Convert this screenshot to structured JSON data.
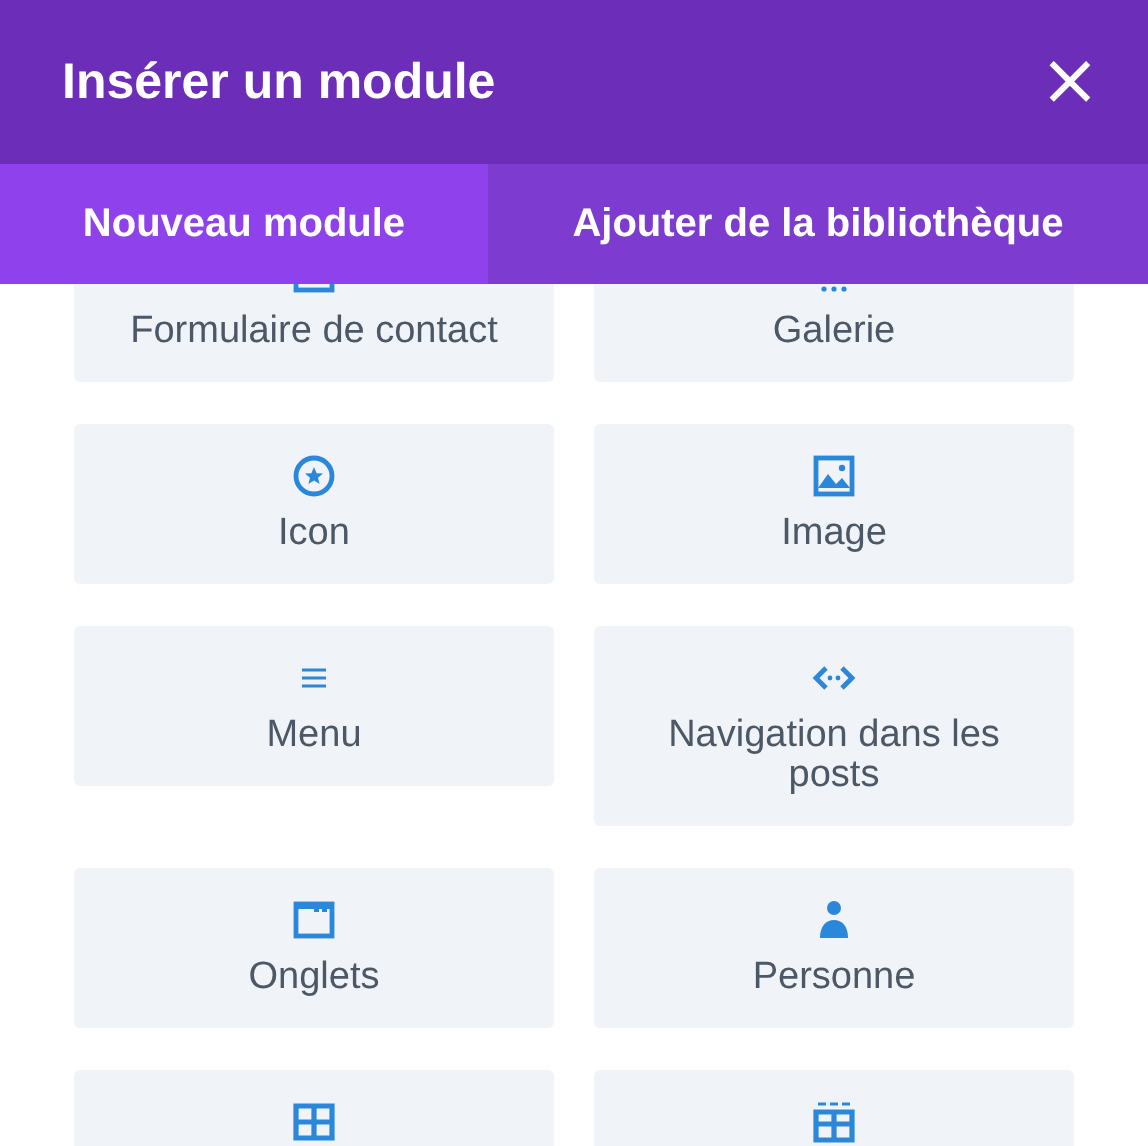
{
  "window": {
    "title": "Insérer un module",
    "close": "×"
  },
  "tabs": [
    {
      "label": "Nouveau module",
      "selected": true
    },
    {
      "label": "Ajouter de la bibliothèque",
      "selected": false
    }
  ],
  "modules": [
    {
      "kind": "contact-form",
      "label": "Formulaire de contact"
    },
    {
      "kind": "gallery",
      "label": "Galerie"
    },
    {
      "kind": "icon",
      "label": "Icon"
    },
    {
      "kind": "image",
      "label": "Image"
    },
    {
      "kind": "menu",
      "label": "Menu"
    },
    {
      "kind": "post-navigation",
      "label": "Navigation dans les posts"
    },
    {
      "kind": "tabs",
      "label": "Onglets"
    },
    {
      "kind": "person",
      "label": "Personne"
    },
    {
      "kind": "table"
    },
    {
      "kind": "grid-table"
    }
  ]
}
